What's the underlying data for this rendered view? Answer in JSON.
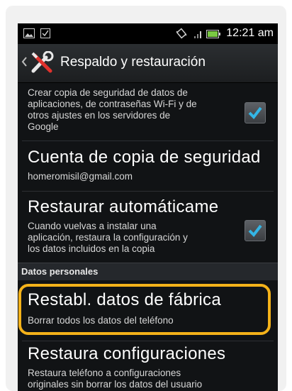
{
  "status_bar": {
    "time": "12:21 am",
    "icons": [
      "image-icon",
      "checkbox-notification-icon",
      "vibrate-icon",
      "signal-icon",
      "battery-icon"
    ]
  },
  "action_bar": {
    "title": "Respaldo y restauración",
    "icon": "tools-icon"
  },
  "items": {
    "backup_data": {
      "summary": "Crear copia de seguridad de datos de aplicaciones, de contraseñas Wi-Fi y de otros ajustes en los servidores de Google",
      "line1": "Crear copia de seguridad de datos de",
      "line2": "aplicaciones, de contraseñas Wi-Fi y de",
      "line3": "otros ajustes en los servidores de",
      "line4": "Google",
      "checked": true
    },
    "backup_account": {
      "title": "Cuenta de copia de seguridad",
      "subtitle": "homeromisil@gmail.com"
    },
    "auto_restore": {
      "title": "Restaurar automáticame",
      "line1": "Cuando vuelvas a instalar una",
      "line2": "aplicación, restaura la configuración y",
      "line3": "los datos incluidos en la copia",
      "checked": true
    },
    "section_personal": "Datos personales",
    "factory_reset": {
      "title": "Restabl. datos de fábrica",
      "subtitle": "Borrar todos los datos del teléfono"
    },
    "restore_settings": {
      "title": "Restaura configuraciones",
      "line1": "Restaura teléfono a configuraciones",
      "line2": "originales sin borrar los datos del usuario"
    }
  },
  "colors": {
    "highlight": "#f4b21a",
    "checkmark": "#33b5e5",
    "background": "#111315"
  }
}
